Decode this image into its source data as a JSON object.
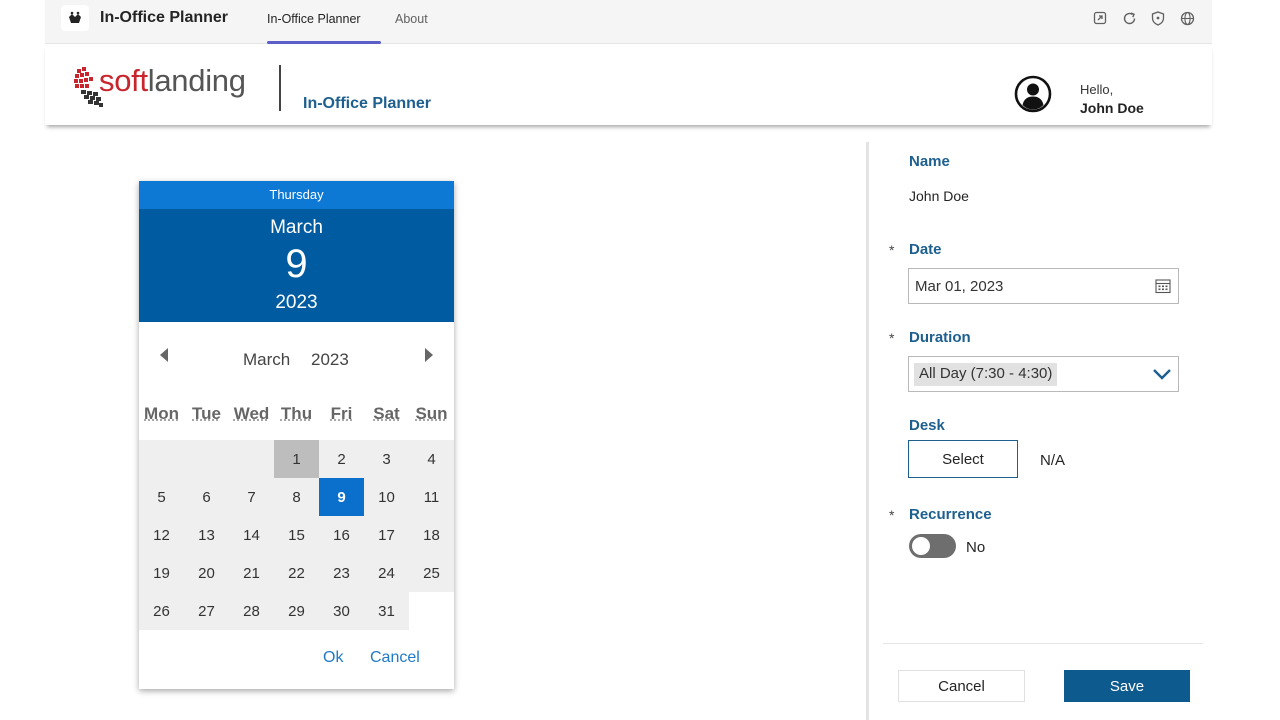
{
  "teams": {
    "app_title": "In-Office Planner",
    "tabs": [
      "In-Office Planner",
      "About"
    ]
  },
  "header": {
    "logo_soft": "soft",
    "logo_landing": "landing",
    "title": "In-Office Planner",
    "hello": "Hello,",
    "user": "John Doe"
  },
  "form": {
    "name_label": "Name",
    "name_value": "John Doe",
    "date_label": "Date",
    "date_value": "Mar 01, 2023",
    "duration_label": "Duration",
    "duration_value": "All Day (7:30 - 4:30)",
    "desk_label": "Desk",
    "desk_button": "Select",
    "desk_value": "N/A",
    "recurrence_label": "Recurrence",
    "recurrence_value": "No",
    "recurrence_on": false,
    "required_marker": "*",
    "cancel": "Cancel",
    "save": "Save"
  },
  "picker": {
    "weekday": "Thursday",
    "month": "March",
    "day": "9",
    "year": "2023",
    "nav_month": "March",
    "nav_year": "2023",
    "days_of_week": [
      "Mon",
      "Tue",
      "Wed",
      "Thu",
      "Fri",
      "Sat",
      "Sun"
    ],
    "first_weekday_index": 3,
    "days_in_month": 31,
    "today": 1,
    "selected": 9,
    "ok": "Ok",
    "cancel": "Cancel"
  },
  "colors": {
    "accent": "#005ba1",
    "label": "#1d5f8f",
    "teams_tab": "#5b5fc7"
  }
}
